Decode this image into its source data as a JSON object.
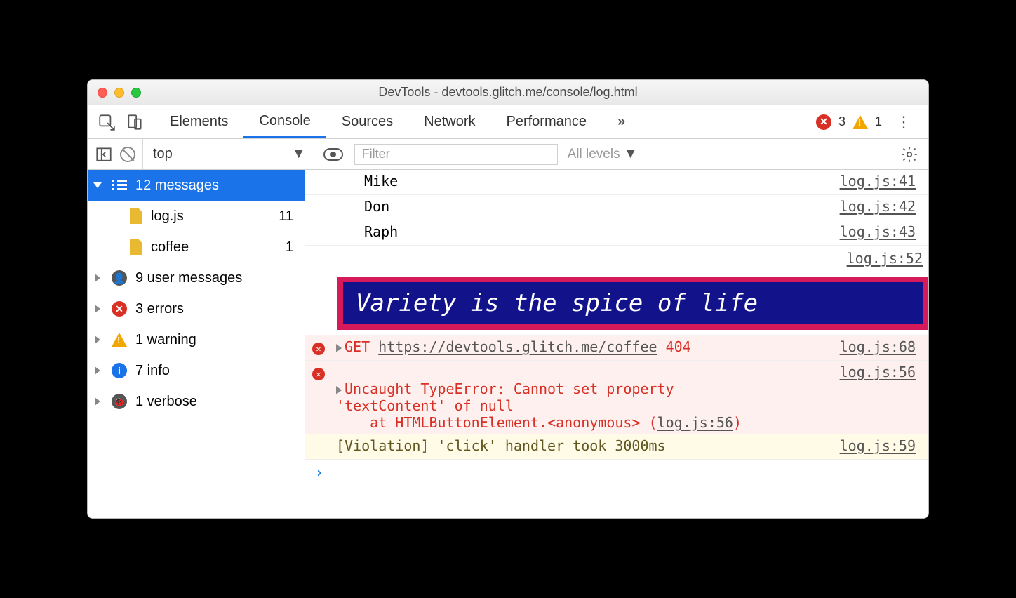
{
  "window": {
    "title": "DevTools - devtools.glitch.me/console/log.html"
  },
  "tabs": {
    "items": [
      "Elements",
      "Console",
      "Sources",
      "Network",
      "Performance"
    ],
    "active": 1,
    "error_count": "3",
    "warn_count": "1"
  },
  "filter": {
    "context": "top",
    "placeholder": "Filter",
    "levels": "All levels"
  },
  "sidebar": {
    "header": {
      "label": "12 messages"
    },
    "files": [
      {
        "name": "log.js",
        "count": "11"
      },
      {
        "name": "coffee",
        "count": "1"
      }
    ],
    "groups": [
      {
        "icon": "user",
        "label": "9 user messages"
      },
      {
        "icon": "error",
        "label": "3 errors"
      },
      {
        "icon": "warn",
        "label": "1 warning"
      },
      {
        "icon": "info",
        "label": "7 info"
      },
      {
        "icon": "verbose",
        "label": "1 verbose"
      }
    ]
  },
  "logs": {
    "simple": [
      {
        "text": "Mike",
        "src": "log.js:41"
      },
      {
        "text": "Don",
        "src": "log.js:42"
      },
      {
        "text": "Raph",
        "src": "log.js:43"
      }
    ],
    "styled": {
      "src": "log.js:52",
      "text": "Variety is the spice of life"
    },
    "net_error": {
      "method": "GET",
      "url": "https://devtools.glitch.me/coffee",
      "status": "404",
      "src": "log.js:68"
    },
    "exception": {
      "line1": "Uncaught TypeError: Cannot set property",
      "line2": "'textContent' of null",
      "line3_a": "    at HTMLButtonElement.<anonymous> (",
      "line3_b": "log.js:56",
      "line3_c": ")",
      "src": "log.js:56"
    },
    "violation": {
      "text": "[Violation] 'click' handler took 3000ms",
      "src": "log.js:59"
    }
  }
}
